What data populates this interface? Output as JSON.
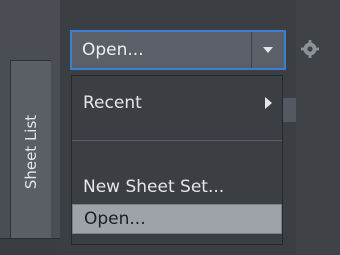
{
  "left_panel": {
    "tab_label": "Sheet List"
  },
  "combo": {
    "value": "Open...",
    "arrow_icon": "chevron-down-icon"
  },
  "toolbar": {
    "icon": "gear-icon"
  },
  "menu": {
    "items": [
      {
        "label": "Recent",
        "has_submenu": true
      },
      {
        "label": "New Sheet Set..."
      },
      {
        "label": "Open...",
        "highlighted": true
      }
    ]
  },
  "colors": {
    "focus_border": "#3c7fd1",
    "highlight_bg": "#9ea3aa",
    "panel_bg": "#3b3f44",
    "text": "#e6e6e6"
  }
}
